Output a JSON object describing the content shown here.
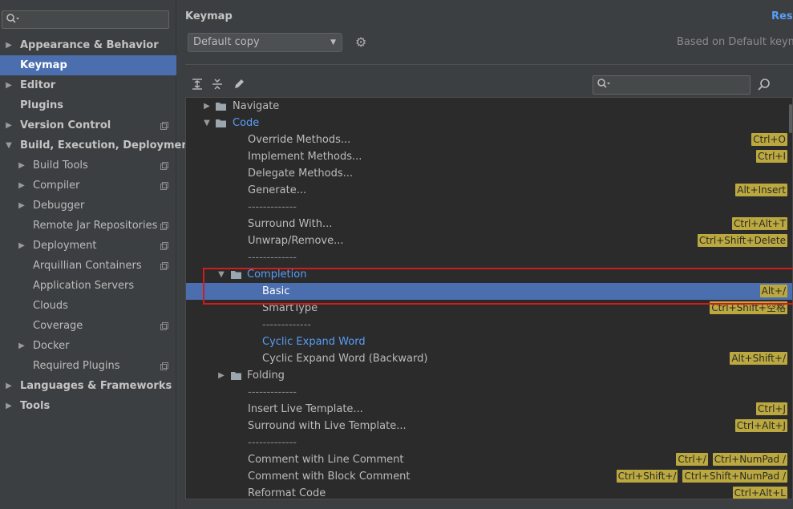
{
  "sidebar": {
    "search": {
      "placeholder": "",
      "value": ""
    },
    "items": [
      {
        "label": "Appearance & Behavior",
        "arrow": "▶",
        "bold": true,
        "indent": 0,
        "proj": false
      },
      {
        "label": "Keymap",
        "arrow": "",
        "bold": true,
        "indent": 0,
        "selected": true,
        "proj": false
      },
      {
        "label": "Editor",
        "arrow": "▶",
        "bold": true,
        "indent": 0,
        "proj": false
      },
      {
        "label": "Plugins",
        "arrow": "",
        "bold": true,
        "indent": 0,
        "proj": false
      },
      {
        "label": "Version Control",
        "arrow": "▶",
        "bold": true,
        "indent": 0,
        "proj": true
      },
      {
        "label": "Build, Execution, Deployment",
        "arrow": "▼",
        "bold": true,
        "indent": 0,
        "proj": false
      },
      {
        "label": "Build Tools",
        "arrow": "▶",
        "bold": false,
        "indent": 1,
        "proj": true
      },
      {
        "label": "Compiler",
        "arrow": "▶",
        "bold": false,
        "indent": 1,
        "proj": true
      },
      {
        "label": "Debugger",
        "arrow": "▶",
        "bold": false,
        "indent": 1,
        "proj": false
      },
      {
        "label": "Remote Jar Repositories",
        "arrow": "",
        "bold": false,
        "indent": 1,
        "proj": true
      },
      {
        "label": "Deployment",
        "arrow": "▶",
        "bold": false,
        "indent": 1,
        "proj": true
      },
      {
        "label": "Arquillian Containers",
        "arrow": "",
        "bold": false,
        "indent": 1,
        "proj": true
      },
      {
        "label": "Application Servers",
        "arrow": "",
        "bold": false,
        "indent": 1,
        "proj": false
      },
      {
        "label": "Clouds",
        "arrow": "",
        "bold": false,
        "indent": 1,
        "proj": false
      },
      {
        "label": "Coverage",
        "arrow": "",
        "bold": false,
        "indent": 1,
        "proj": true
      },
      {
        "label": "Docker",
        "arrow": "▶",
        "bold": false,
        "indent": 1,
        "proj": false
      },
      {
        "label": "Required Plugins",
        "arrow": "",
        "bold": false,
        "indent": 1,
        "proj": true
      },
      {
        "label": "Languages & Frameworks",
        "arrow": "▶",
        "bold": true,
        "indent": 0,
        "proj": false
      },
      {
        "label": "Tools",
        "arrow": "▶",
        "bold": true,
        "indent": 0,
        "proj": false
      }
    ]
  },
  "header": {
    "title": "Keymap",
    "reset_label": "Rese",
    "scheme_value": "Default copy",
    "based_on": "Based on Default keymap"
  },
  "tree_search": {
    "value": ""
  },
  "tree": [
    {
      "label": "Navigate",
      "level": 1,
      "arrow": "▶",
      "folder": true,
      "style": "normal",
      "shortcuts": []
    },
    {
      "label": "Code",
      "level": 1,
      "arrow": "▼",
      "folder": true,
      "style": "blue",
      "shortcuts": []
    },
    {
      "label": "Override Methods...",
      "level": 2,
      "arrow": "",
      "folder": false,
      "style": "normal",
      "shortcuts": [
        "Ctrl+O"
      ]
    },
    {
      "label": "Implement Methods...",
      "level": 2,
      "arrow": "",
      "folder": false,
      "style": "normal",
      "shortcuts": [
        "Ctrl+I"
      ]
    },
    {
      "label": "Delegate Methods...",
      "level": 2,
      "arrow": "",
      "folder": false,
      "style": "normal",
      "shortcuts": []
    },
    {
      "label": "Generate...",
      "level": 2,
      "arrow": "",
      "folder": false,
      "style": "normal",
      "shortcuts": [
        "Alt+Insert"
      ]
    },
    {
      "label": "-------------",
      "level": 2,
      "arrow": "",
      "folder": false,
      "style": "dashes",
      "shortcuts": []
    },
    {
      "label": "Surround With...",
      "level": 2,
      "arrow": "",
      "folder": false,
      "style": "normal",
      "shortcuts": [
        "Ctrl+Alt+T"
      ]
    },
    {
      "label": "Unwrap/Remove...",
      "level": 2,
      "arrow": "",
      "folder": false,
      "style": "normal",
      "shortcuts": [
        "Ctrl+Shift+Delete"
      ]
    },
    {
      "label": "-------------",
      "level": 2,
      "arrow": "",
      "folder": false,
      "style": "dashes",
      "shortcuts": []
    },
    {
      "label": "Completion",
      "level": 2,
      "arrow": "▼",
      "folder": true,
      "style": "blue",
      "shortcuts": []
    },
    {
      "label": "Basic",
      "level": 3,
      "arrow": "",
      "folder": false,
      "style": "normal",
      "selected": true,
      "shortcuts": [
        "Alt+/"
      ]
    },
    {
      "label": "SmartType",
      "level": 3,
      "arrow": "",
      "folder": false,
      "style": "normal",
      "shortcuts": [
        "Ctrl+Shift+空格"
      ]
    },
    {
      "label": "-------------",
      "level": 3,
      "arrow": "",
      "folder": false,
      "style": "dashes",
      "shortcuts": []
    },
    {
      "label": "Cyclic Expand Word",
      "level": 3,
      "arrow": "",
      "folder": false,
      "style": "blue",
      "shortcuts": []
    },
    {
      "label": "Cyclic Expand Word (Backward)",
      "level": 3,
      "arrow": "",
      "folder": false,
      "style": "normal",
      "shortcuts": [
        "Alt+Shift+/"
      ]
    },
    {
      "label": "Folding",
      "level": 2,
      "arrow": "▶",
      "folder": true,
      "style": "normal",
      "shortcuts": []
    },
    {
      "label": "-------------",
      "level": 2,
      "arrow": "",
      "folder": false,
      "style": "dashes",
      "shortcuts": []
    },
    {
      "label": "Insert Live Template...",
      "level": 2,
      "arrow": "",
      "folder": false,
      "style": "normal",
      "shortcuts": [
        "Ctrl+J"
      ]
    },
    {
      "label": "Surround with Live Template...",
      "level": 2,
      "arrow": "",
      "folder": false,
      "style": "normal",
      "shortcuts": [
        "Ctrl+Alt+J"
      ]
    },
    {
      "label": "-------------",
      "level": 2,
      "arrow": "",
      "folder": false,
      "style": "dashes",
      "shortcuts": []
    },
    {
      "label": "Comment with Line Comment",
      "level": 2,
      "arrow": "",
      "folder": false,
      "style": "normal",
      "shortcuts": [
        "Ctrl+/",
        "Ctrl+NumPad /"
      ]
    },
    {
      "label": "Comment with Block Comment",
      "level": 2,
      "arrow": "",
      "folder": false,
      "style": "normal",
      "shortcuts": [
        "Ctrl+Shift+/",
        "Ctrl+Shift+NumPad /"
      ]
    },
    {
      "label": "Reformat Code",
      "level": 2,
      "arrow": "",
      "folder": false,
      "style": "normal",
      "shortcuts": [
        "Ctrl+Alt+L"
      ]
    }
  ],
  "colors": {
    "accent": "#4b6eaf",
    "link": "#589df6",
    "shortcut_bg": "#bba83e",
    "highlight_box": "#d21b1b"
  },
  "icons": {
    "search": "search-icon",
    "gear": "gear-icon",
    "expand_all": "expand-all-icon",
    "collapse_all": "collapse-all-icon",
    "edit": "pencil-icon",
    "find_by_shortcut": "find-shortcut-icon",
    "folder": "folder-icon"
  }
}
